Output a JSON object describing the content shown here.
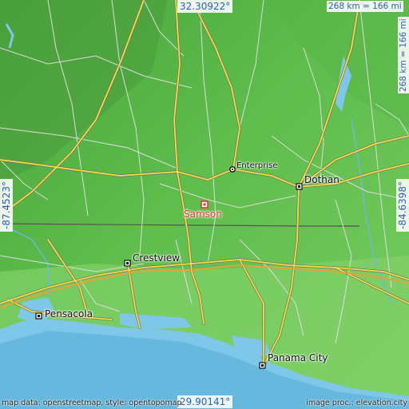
{
  "map": {
    "colors": {
      "land": "#5dbb4a",
      "land_low": "#7fd268",
      "land_high": "#3f9c3a",
      "water": "#76c3e6",
      "coast_water": "#9fd7ee",
      "road_major": "#f2e23a",
      "road_outline": "#777777",
      "road_minor": "#d8d8d8",
      "state_line": "#555555",
      "target": "#e23a3a",
      "coord_text": "#2f5fb3"
    },
    "places": {
      "target": "Samson",
      "enterprise": "Enterprise",
      "dothan": "Dothan",
      "crestview": "Crestview",
      "pensacola": "Pensacola",
      "panama_city": "Panama City"
    },
    "coordinates": {
      "top": "32.30922°",
      "bottom": "29.90141°",
      "left": "-87.4523°",
      "right": "-84.6398°"
    },
    "scale": {
      "horizontal": "268 km = 166 mi",
      "vertical": "268 km = 166 mi"
    },
    "credits": {
      "left": "map data: openstreetmap, style: opentopomap",
      "right": "image proc.: elevation.city"
    }
  }
}
